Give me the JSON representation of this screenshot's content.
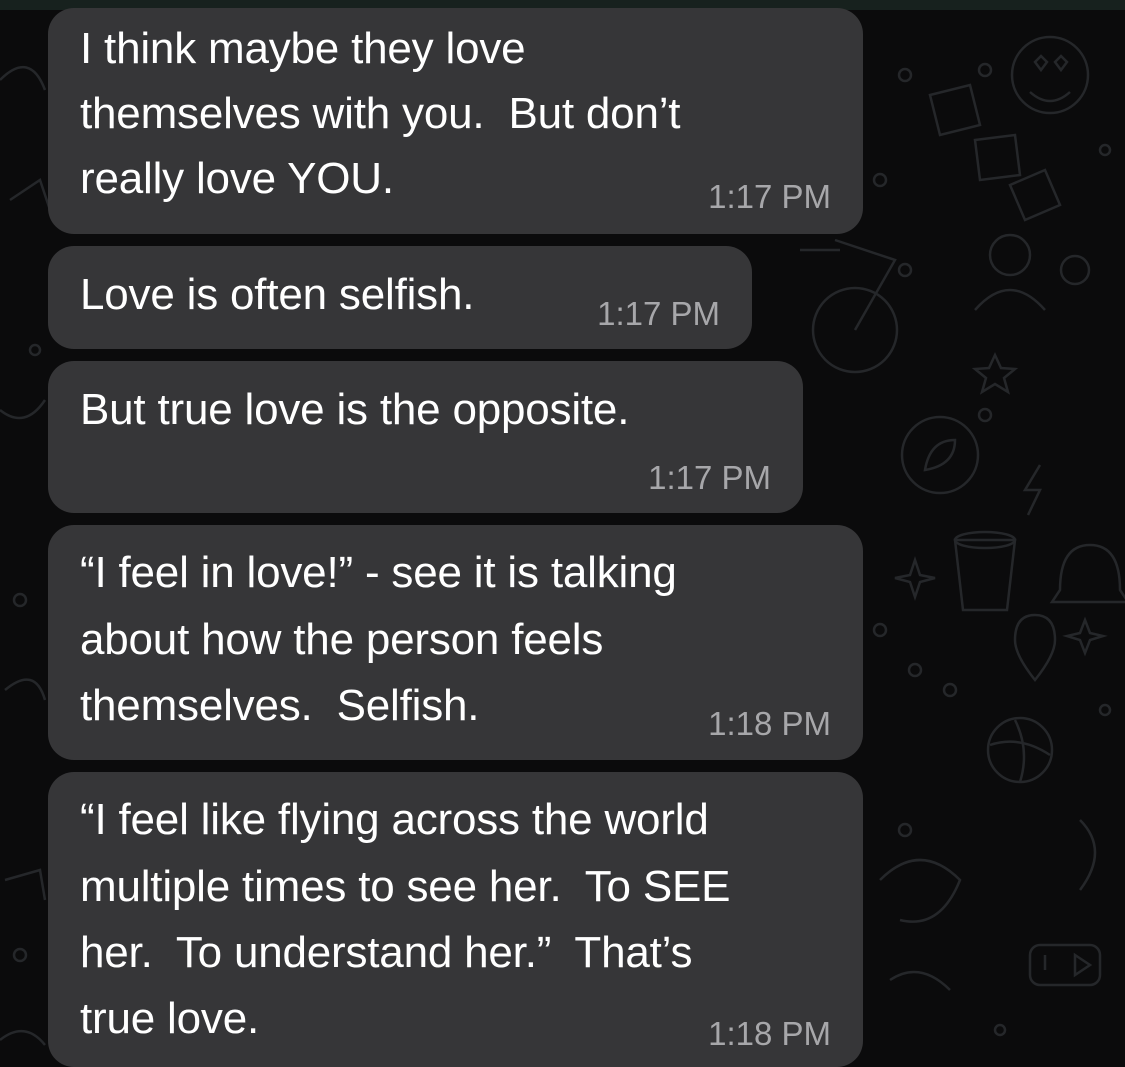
{
  "theme": {
    "background": "#0b0b0c",
    "bubble_color": "#363638",
    "text_color": "#ffffff",
    "timestamp_color": "#a7a7aa"
  },
  "wallpaper": {
    "doodles": [
      "smiley-icon",
      "bff-sticker",
      "bicycle-icon",
      "people-icon",
      "star-icon",
      "leaf-icon",
      "coffee-cup-icon",
      "bell-icon",
      "location-pin-icon",
      "basketball-icon",
      "microphone-icon",
      "lightning-icon"
    ]
  },
  "messages": [
    {
      "lines": [
        "I think maybe they love",
        "themselves with you.  But don’t",
        "really love YOU."
      ],
      "time": "1:17 PM"
    },
    {
      "lines": [
        "Love is often selfish."
      ],
      "time": "1:17 PM"
    },
    {
      "lines": [
        "But true love is the opposite."
      ],
      "time": "1:17 PM"
    },
    {
      "lines": [
        "“I feel in love!” - see it is talking",
        "about how the person feels",
        "themselves.  Selfish."
      ],
      "time": "1:18 PM"
    },
    {
      "lines": [
        "“I feel like flying across the world",
        "multiple times to see her.  To SEE",
        "her.  To understand her.”  That’s",
        "true love."
      ],
      "time": "1:18 PM"
    }
  ]
}
